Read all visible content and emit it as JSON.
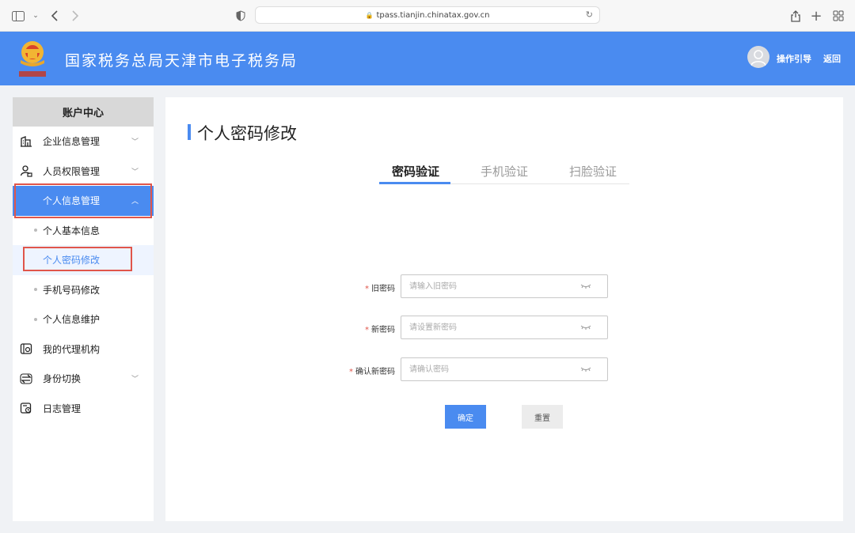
{
  "browser": {
    "url": "tpass.tianjin.chinatax.gov.cn"
  },
  "header": {
    "title": "国家税务总局天津市电子税务局",
    "guide_label": "操作引导",
    "back_label": "返回"
  },
  "sidebar": {
    "title": "账户中心",
    "items": [
      {
        "label": "企业信息管理",
        "icon": "building-icon",
        "expandable": true
      },
      {
        "label": "人员权限管理",
        "icon": "user-lock-icon",
        "expandable": true
      },
      {
        "label": "个人信息管理",
        "icon": "",
        "expandable": true,
        "expanded": true
      },
      {
        "label": "个人基本信息",
        "sub": true
      },
      {
        "label": "个人密码修改",
        "sub": true,
        "current": true
      },
      {
        "label": "手机号码修改",
        "sub": true
      },
      {
        "label": "个人信息维护",
        "sub": true
      },
      {
        "label": "我的代理机构",
        "icon": "agency-icon",
        "expandable": false
      },
      {
        "label": "身份切换",
        "icon": "switch-icon",
        "expandable": true
      },
      {
        "label": "日志管理",
        "icon": "log-icon",
        "expandable": false
      }
    ]
  },
  "main": {
    "title": "个人密码修改",
    "tabs": [
      {
        "label": "密码验证",
        "active": true
      },
      {
        "label": "手机验证",
        "active": false
      },
      {
        "label": "扫脸验证",
        "active": false
      }
    ],
    "form": {
      "old_password": {
        "label": "旧密码",
        "placeholder": "请输入旧密码"
      },
      "new_password": {
        "label": "新密码",
        "placeholder": "请设置新密码"
      },
      "confirm_password": {
        "label": "确认新密码",
        "placeholder": "请确认密码"
      },
      "required_mark": "*"
    },
    "confirm_label": "确定",
    "reset_label": "重置"
  },
  "colors": {
    "accent": "#4a8bf0",
    "highlight": "#e0554a"
  }
}
